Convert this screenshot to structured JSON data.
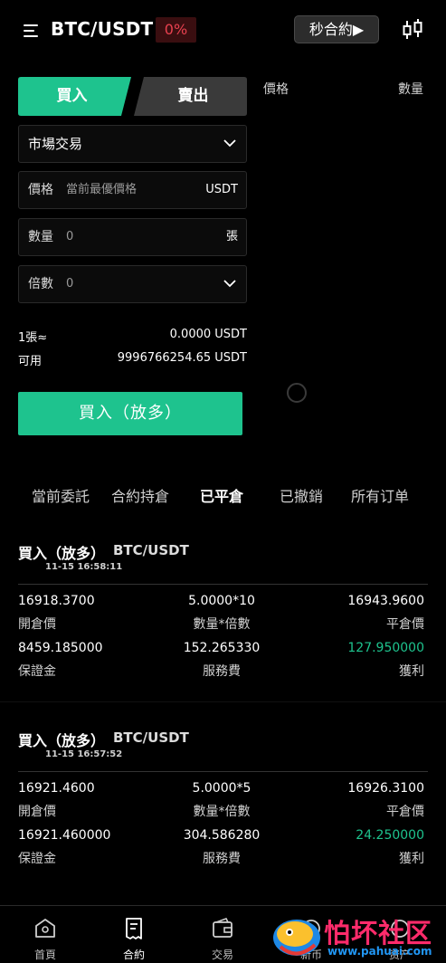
{
  "header": {
    "pair": "BTC/USDT",
    "change": "0%",
    "second_contract_label": "秒合約▶",
    "menu_icon": "menu-icon",
    "chart_icon": "candlestick-chart-icon"
  },
  "form": {
    "buy_tab": "買入",
    "sell_tab": "賣出",
    "order_type": "市場交易",
    "price_label": "價格",
    "price_placeholder": "當前最優價格",
    "price_unit": "USDT",
    "qty_label": "數量",
    "qty_value": "0",
    "qty_unit": "張",
    "leverage_label": "倍數",
    "leverage_value": "0",
    "per_lot_label": "1張≈",
    "per_lot_value": "0.0000 USDT",
    "available_label": "可用",
    "available_value": "9996766254.65 USDT",
    "submit_label": "買入（放多）"
  },
  "orderbook": {
    "price_header": "價格",
    "qty_header": "數量"
  },
  "order_tabs": [
    "當前委託",
    "合約持倉",
    "已平倉",
    "已撤銷",
    "所有订单"
  ],
  "orders": [
    {
      "title": "買入（放多）",
      "pair": "BTC/USDT",
      "time": "11-15 16:58:11",
      "open_price": "16918.3700",
      "open_price_label": "開倉價",
      "qty_leverage": "5.0000*10",
      "qty_leverage_label": "數量*倍數",
      "close_price": "16943.9600",
      "close_price_label": "平倉價",
      "margin": "8459.185000",
      "margin_label": "保證金",
      "fee": "152.265330",
      "fee_label": "服務費",
      "profit": "127.950000",
      "profit_label": "獲利"
    },
    {
      "title": "買入（放多）",
      "pair": "BTC/USDT",
      "time": "11-15 16:57:52",
      "open_price": "16921.4600",
      "open_price_label": "開倉價",
      "qty_leverage": "5.0000*5",
      "qty_leverage_label": "數量*倍數",
      "close_price": "16926.3100",
      "close_price_label": "平倉價",
      "margin": "16921.460000",
      "margin_label": "保證金",
      "fee": "304.586280",
      "fee_label": "服務費",
      "profit": "24.250000",
      "profit_label": "獲利"
    }
  ],
  "nav": [
    {
      "label": "首頁",
      "icon": "home-icon"
    },
    {
      "label": "合約",
      "icon": "contract-icon"
    },
    {
      "label": "交易",
      "icon": "wallet-icon"
    },
    {
      "label": "新币",
      "icon": "new-coin-icon"
    },
    {
      "label": "资产",
      "icon": "asset-icon"
    }
  ],
  "watermark": {
    "text": "怕坏社区",
    "url": "www.pahuai.com"
  },
  "colors": {
    "buy_green": "#1ec38e",
    "sell_gray": "#3a3a3a",
    "down_red": "#e8414f",
    "background": "#000000"
  }
}
